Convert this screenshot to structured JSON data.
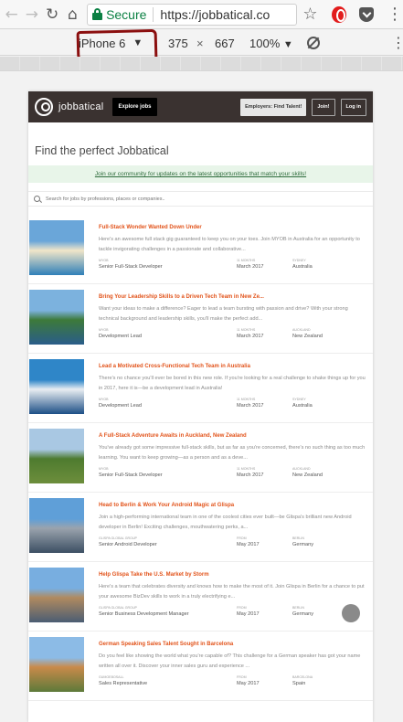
{
  "browser": {
    "back_glyph": "←",
    "forward_glyph": "→",
    "reload_glyph": "↻",
    "home_glyph": "⌂",
    "secure_label": "Secure",
    "url": "https://jobbatical.co",
    "star_glyph": "☆",
    "menu_glyph": "⋮"
  },
  "device_toolbar": {
    "device": "iPhone 6",
    "dropdown_glyph": "▼",
    "width": "375",
    "times": "×",
    "height": "667",
    "zoom": "100%",
    "zoom_glyph": "▼",
    "more_glyph": "⋮"
  },
  "site": {
    "logo_text": "jobbatical",
    "explore_label": "Explore jobs",
    "employers_label": "Employers: Find Talent!",
    "join_label": "Join!",
    "login_label": "Log in",
    "hero_title": "Find the perfect Jobbatical",
    "community_link": "Join our community for updates on the latest opportunities that match your skills!",
    "search_placeholder": "Search for jobs by professions, places or companies.."
  },
  "jobs": [
    {
      "title": "Full-Stack Wonder Wanted Down Under",
      "desc": "Here's an awesome full stack gig guaranteed to keep you on your toes. Join MYOB in Australia for an opportunity to tackle invigorating challenges in a passionate and collaborative...",
      "company": "MYOB",
      "role": "Senior Full-Stack Developer",
      "start_label": "11 MONTHS",
      "start": "March 2017",
      "loc_label": "SYDNEY",
      "location": "Australia",
      "palette": [
        "#6aa6d9",
        "#f1e6c9",
        "#2f7fb8"
      ]
    },
    {
      "title": "Bring Your Leadership Skills to a Driven Tech Team in New Ze...",
      "desc": "Want your ideas to make a difference? Eager to lead a team bursting with passion and drive? With your strong technical background and leadership skills, you'll make the perfect add...",
      "company": "MYOB",
      "role": "Development Lead",
      "start_label": "11 MONTHS",
      "start": "March 2017",
      "loc_label": "AUCKLAND",
      "location": "New Zealand",
      "palette": [
        "#7cb2de",
        "#3d7a3a",
        "#2a5d8a"
      ]
    },
    {
      "title": "Lead a Motivated Cross-Functional Tech Team in Australia",
      "desc": "There's no chance you'll ever be bored in this new role. If you're looking for a real challenge to shake things up for you in 2017, here it is—be a development lead in Australia!",
      "company": "MYOB",
      "role": "Development Lead",
      "start_label": "11 MONTHS",
      "start": "March 2017",
      "loc_label": "SYDNEY",
      "location": "Australia",
      "palette": [
        "#2f86c8",
        "#e9eef2",
        "#1d4f86"
      ]
    },
    {
      "title": "A Full-Stack Adventure Awaits in Auckland, New Zealand",
      "desc": "You've already got some impressive full-stack skills, but as far as you're concerned, there's no such thing as too much learning. You want to keep growing—as a person and as a deve...",
      "company": "MYOB",
      "role": "Senior Full-Stack Developer",
      "start_label": "11 MONTHS",
      "start": "March 2017",
      "loc_label": "AUCKLAND",
      "location": "New Zealand",
      "palette": [
        "#a9c8e3",
        "#4e7b2f",
        "#6d8e3c"
      ]
    },
    {
      "title": "Head to Berlin & Work Your Android Magic at Glispa",
      "desc": "Join a high-performing international team in one of the coolest cities ever built—be Glispa's brilliant new Android developer in Berlin! Exciting challenges, mouthwatering perks, a...",
      "company": "GLISPA GLOBAL GROUP",
      "role": "Senior Android Developer",
      "start_label": "FROM",
      "start": "May 2017",
      "loc_label": "BERLIN",
      "location": "Germany",
      "palette": [
        "#5f9fd8",
        "#9aa3ad",
        "#3c4f63"
      ]
    },
    {
      "title": "Help Glispa Take the U.S. Market by Storm",
      "desc": "Here's a team that celebrates diversity and knows how to make the most of it. Join Glispa in Berlin for a chance to put your awesome BizDev skills to work in a truly electrifying e...",
      "company": "GLISPA GLOBAL GROUP",
      "role": "Senior Business Development Manager",
      "start_label": "FROM",
      "start": "May 2017",
      "loc_label": "BERLIN",
      "location": "Germany",
      "palette": [
        "#78aee0",
        "#b08a5f",
        "#4b5d73"
      ]
    },
    {
      "title": "German Speaking Sales Talent Sought in Barcelona",
      "desc": "Do you feel like showing the world what you're capable of? This challenge for a German speaker has got your name written all over it. Discover your inner sales guru and experience ...",
      "company": "GUMOEBOSALL",
      "role": "Sales Representative",
      "start_label": "FROM",
      "start": "May 2017",
      "loc_label": "BARCELONA",
      "location": "Spain",
      "palette": [
        "#8cbbe6",
        "#c98a4a",
        "#5d7a3a"
      ]
    }
  ]
}
